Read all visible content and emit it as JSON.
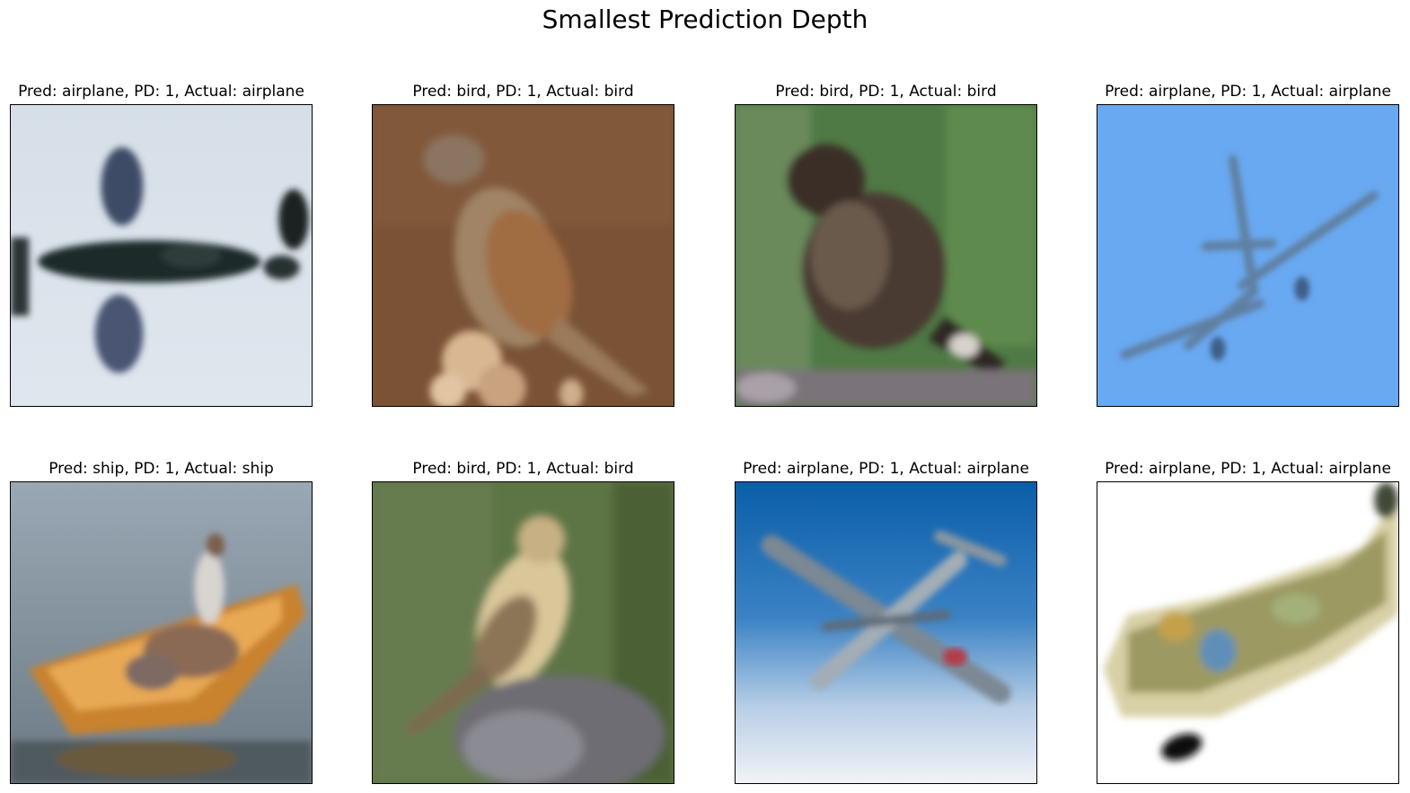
{
  "figure": {
    "title": "Smallest Prediction Depth"
  },
  "panels": [
    {
      "title": "Pred: airplane, PD: 1, Actual: airplane",
      "subject": "fighter airplane against pale sky"
    },
    {
      "title": "Pred: bird, PD: 1, Actual: bird",
      "subject": "sparrow perched on branch, brown background"
    },
    {
      "title": "Pred: bird, PD: 1, Actual: bird",
      "subject": "dark sparrow on rock, green background"
    },
    {
      "title": "Pred: airplane, PD: 1, Actual: airplane",
      "subject": "jet airplane from below against blue sky"
    },
    {
      "title": "Pred: ship, PD: 1, Actual: ship",
      "subject": "person in orange rowboat on water"
    },
    {
      "title": "Pred: bird, PD: 1, Actual: bird",
      "subject": "small bird on mossy rock, green background"
    },
    {
      "title": "Pred: airplane, PD: 1, Actual: airplane",
      "subject": "aircraft against blue gradient sky"
    },
    {
      "title": "Pred: airplane, PD: 1, Actual: airplane",
      "subject": "camouflaged airplane on white background"
    }
  ]
}
